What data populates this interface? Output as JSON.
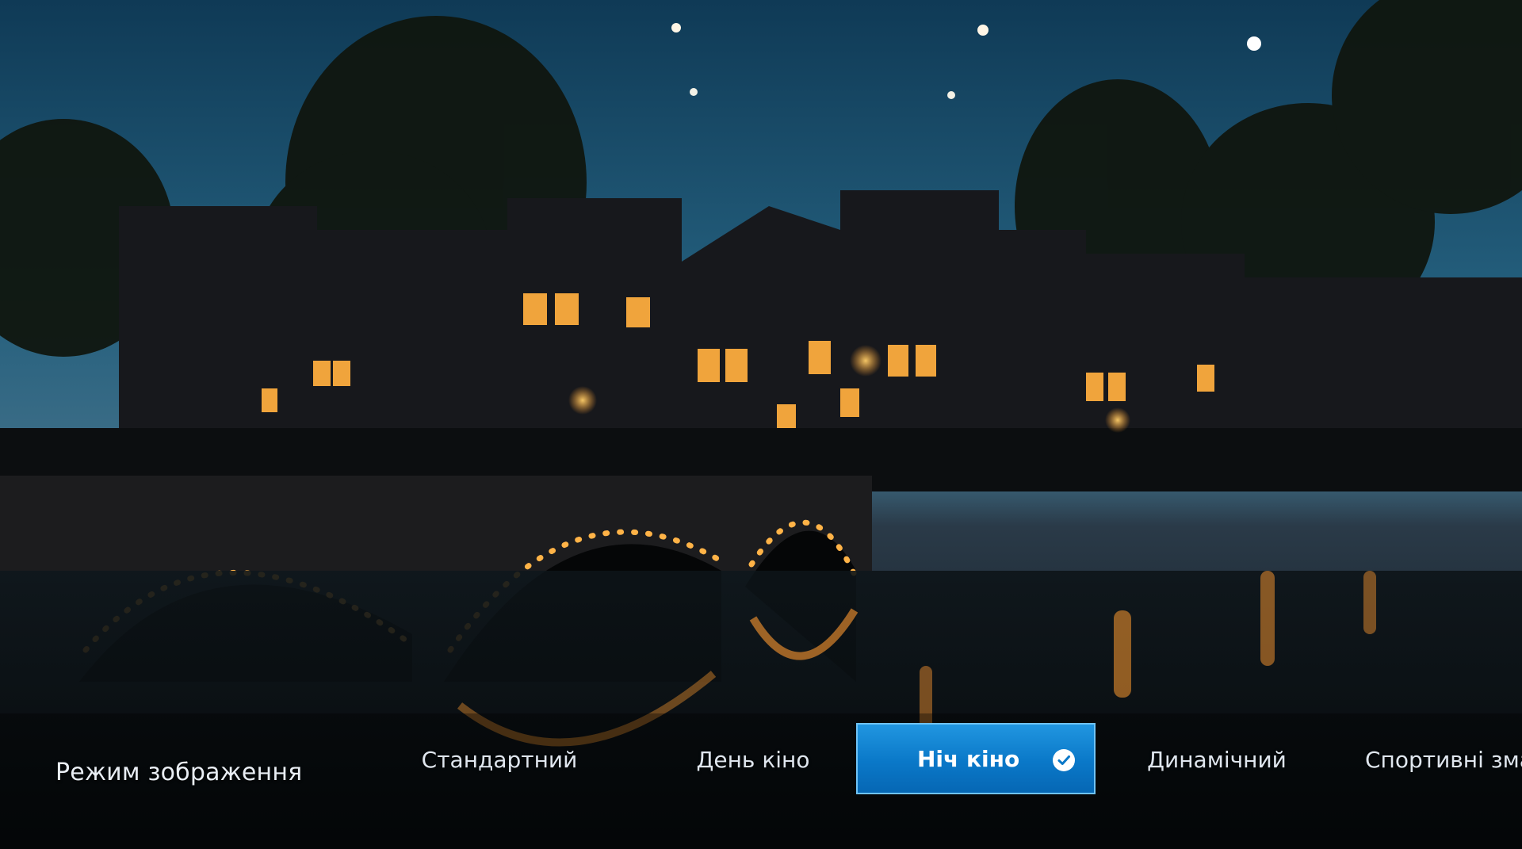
{
  "picture_menu": {
    "title": "Режим зображення",
    "modes": [
      {
        "label": "Стандартний",
        "selected": false
      },
      {
        "label": "День кіно",
        "selected": false
      },
      {
        "label": "Ніч кіно",
        "selected": true
      },
      {
        "label": "Динамічний",
        "selected": false
      },
      {
        "label": "Спортивні зма",
        "selected": false
      }
    ],
    "selected_icon": "checkmark-icon"
  },
  "colors": {
    "selected_background": "#0a78c8",
    "selected_border": "#6fc3f6",
    "text": "#dfe6ee"
  }
}
